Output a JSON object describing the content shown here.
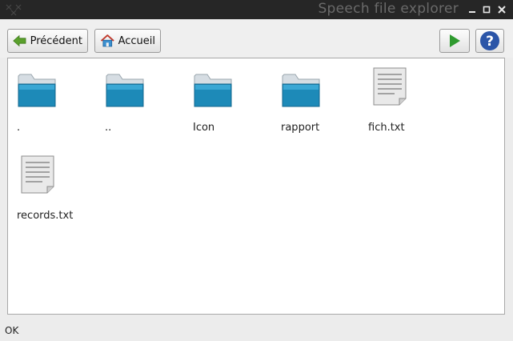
{
  "window": {
    "title": "Speech file explorer",
    "controls": {
      "minimize": "▄",
      "maximize": "■",
      "close": "✕"
    }
  },
  "toolbar": {
    "back_label": "Précédent",
    "home_label": "Accueil",
    "back_icon": "arrow-left-icon",
    "home_icon": "house-icon",
    "play_icon": "play-icon",
    "help_icon": "help-icon"
  },
  "files": [
    {
      "name": ".",
      "type": "folder"
    },
    {
      "name": "..",
      "type": "folder"
    },
    {
      "name": "Icon",
      "type": "folder"
    },
    {
      "name": "rapport",
      "type": "folder"
    },
    {
      "name": "fich.txt",
      "type": "text-file"
    },
    {
      "name": "records.txt",
      "type": "text-file"
    }
  ],
  "status": {
    "text": "OK"
  },
  "colors": {
    "titlebar_bg": "#262626",
    "folder_blue": "#1d8ab8",
    "play_green": "#2e9a2e",
    "help_blue": "#2b55a8",
    "back_green": "#5aa02c"
  }
}
